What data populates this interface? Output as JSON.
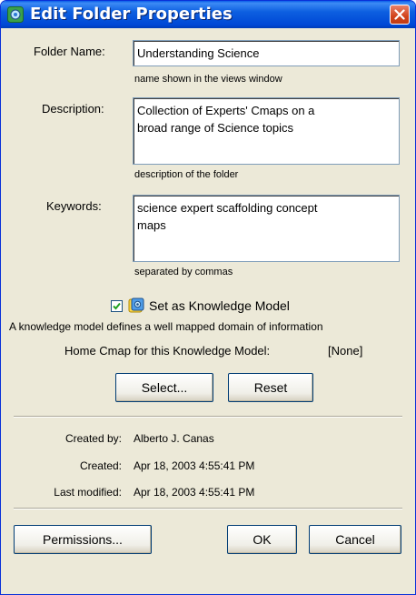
{
  "window": {
    "title": "Edit Folder Properties",
    "icon": "cmap-folder-icon",
    "close": "close-icon"
  },
  "folder_name": {
    "label": "Folder Name:",
    "value": "Understanding Science",
    "hint": "name shown in the views window"
  },
  "description": {
    "label": "Description:",
    "value_line1": "Collection of Experts' Cmaps on a",
    "value_line2": "broad range of Science topics",
    "hint": "description of the folder"
  },
  "keywords": {
    "label": "Keywords:",
    "value_line1": "science expert scaffolding concept",
    "value_line2": "maps",
    "hint": "separated by commas"
  },
  "knowledge_model": {
    "checkbox_label": "Set as Knowledge Model",
    "checked": true,
    "explanation": "A knowledge model defines a well mapped domain of information",
    "home_label": "Home Cmap for this Knowledge Model:",
    "home_value": "[None]",
    "select_button": "Select...",
    "reset_button": "Reset"
  },
  "meta": {
    "created_by_label": "Created by:",
    "created_by_value": "Alberto J. Canas",
    "created_label": "Created:",
    "created_value": "Apr 18, 2003 4:55:41 PM",
    "modified_label": "Last modified:",
    "modified_value": "Apr 18, 2003 4:55:41 PM"
  },
  "buttons": {
    "permissions": "Permissions...",
    "ok": "OK",
    "cancel": "Cancel"
  },
  "colors": {
    "titlebar": "#0054e3",
    "dialog_bg": "#ece9d8",
    "close_button": "#d2441b"
  }
}
